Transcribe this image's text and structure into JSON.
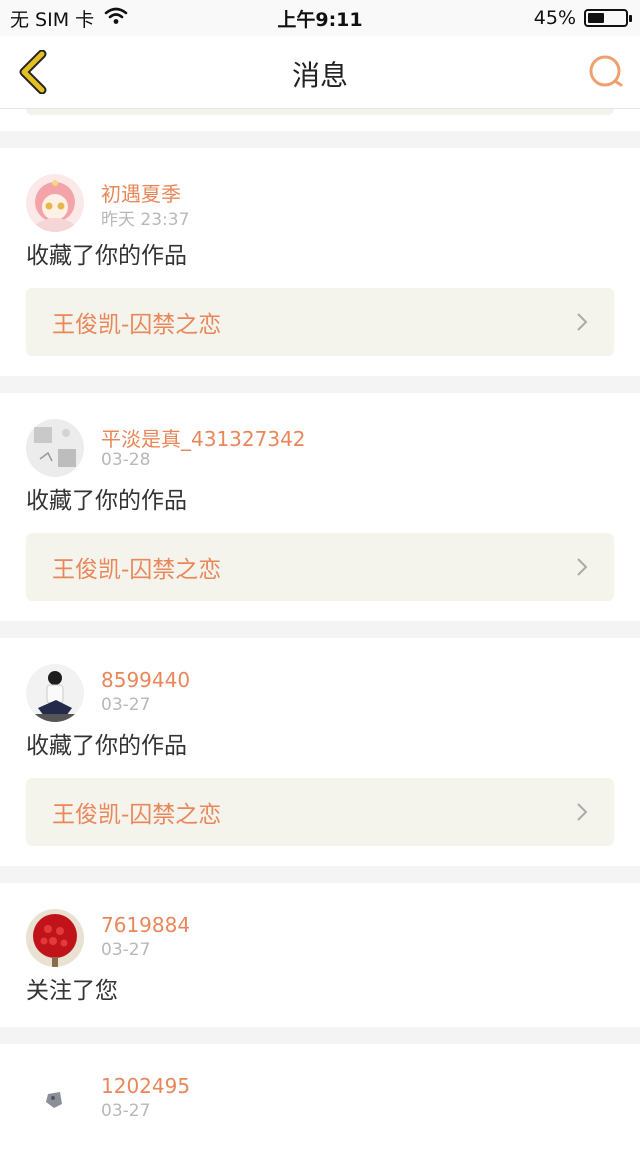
{
  "status_bar": {
    "carrier": "无 SIM 卡",
    "time": "上午9:11",
    "battery_percent": "45%",
    "battery_level": 0.45,
    "wifi_icon": "wifi-icon"
  },
  "nav": {
    "title": "消息",
    "back_icon": "chevron-left-icon",
    "search_icon": "search-icon"
  },
  "messages": [
    {
      "username": "初遇夏季",
      "time": "昨天 23:37",
      "action": "收藏了你的作品",
      "work": "王俊凯-囚禁之恋"
    },
    {
      "username": "平淡是真_431327342",
      "time": "03-28",
      "action": "收藏了你的作品",
      "work": "王俊凯-囚禁之恋"
    },
    {
      "username": "8599440",
      "time": "03-27",
      "action": "收藏了你的作品",
      "work": "王俊凯-囚禁之恋"
    },
    {
      "username": "7619884",
      "time": "03-27",
      "action": "关注了您"
    },
    {
      "username": "1202495",
      "time": "03-27"
    }
  ],
  "colors": {
    "accent": "#e9875a",
    "back_icon": "#e2c021",
    "link_bg": "#f4f4ed"
  }
}
